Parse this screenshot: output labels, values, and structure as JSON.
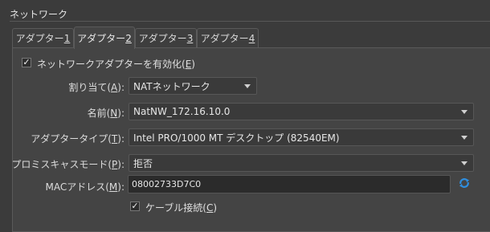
{
  "section": {
    "title": "ネットワーク"
  },
  "tabs": [
    {
      "label": "アダプター ",
      "key": "1"
    },
    {
      "label": "アダプター ",
      "key": "2"
    },
    {
      "label": "アダプター ",
      "key": "3"
    },
    {
      "label": "アダプター ",
      "key": "4"
    }
  ],
  "active_tab": 1,
  "enable_adapter": {
    "label": "ネットワークアダプターを有効化(",
    "key": "E",
    "suffix": ")",
    "checked": true
  },
  "attached_to": {
    "label": "割り当て(",
    "key": "A",
    "suffix": "):",
    "value": "NATネットワーク"
  },
  "name": {
    "label": "名前(",
    "key": "N",
    "suffix": "):",
    "value": "NatNW_172.16.10.0"
  },
  "adapter_type": {
    "label": "アダプタータイプ(",
    "key": "T",
    "suffix": "):",
    "value": "Intel PRO/1000 MT デスクトップ (82540EM)"
  },
  "promiscuous_mode": {
    "label": "プロミスキャスモード(",
    "key": "P",
    "suffix": "):",
    "value": "拒否"
  },
  "mac_address": {
    "label": "MACアドレス(",
    "key": "M",
    "suffix": "):",
    "value": "08002733D7C0",
    "refresh_icon": "refresh-icon"
  },
  "cable_connected": {
    "label": "ケーブル接続(",
    "key": "C",
    "suffix": ")",
    "checked": true
  },
  "colors": {
    "background": "#3b3b3b",
    "panel": "#444444",
    "field": "#2b2b2b",
    "refresh_accent": "#2f8fe0"
  }
}
